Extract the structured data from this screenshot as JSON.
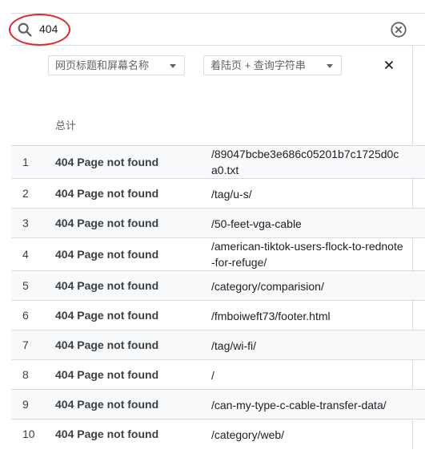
{
  "search": {
    "value": "404"
  },
  "filters": {
    "dimension1": "网页标题和屏幕名称",
    "dimension2_left": "着陆页",
    "dimension2_plus": "+",
    "dimension2_right": "查询字符串"
  },
  "table": {
    "total_label": "总计",
    "rows": [
      {
        "index": "1",
        "title": "404 Page not found",
        "path": "/89047bcbe3e686c05201b7c1725d0ca0.txt"
      },
      {
        "index": "2",
        "title": "404 Page not found",
        "path": "/tag/u-s/"
      },
      {
        "index": "3",
        "title": "404 Page not found",
        "path": "/50-feet-vga-cable"
      },
      {
        "index": "4",
        "title": "404 Page not found",
        "path": "/american-tiktok-users-flock-to-rednote-for-refuge/"
      },
      {
        "index": "5",
        "title": "404 Page not found",
        "path": "/category/comparision/"
      },
      {
        "index": "6",
        "title": "404 Page not found",
        "path": "/fmboiweft73/footer.html"
      },
      {
        "index": "7",
        "title": "404 Page not found",
        "path": "/tag/wi-fi/"
      },
      {
        "index": "8",
        "title": "404 Page not found",
        "path": "/"
      },
      {
        "index": "9",
        "title": "404 Page not found",
        "path": "/can-my-type-c-cable-transfer-data/"
      },
      {
        "index": "10",
        "title": "404 Page not found",
        "path": "/category/web/"
      }
    ]
  },
  "icons": {
    "search": "search-icon",
    "clear": "clear-circle-icon",
    "close": "close-icon",
    "caret": "chevron-down-icon"
  },
  "colors": {
    "highlight": "#e3262b",
    "border": "#dadce0",
    "shaded_row": "#f8f9fa"
  }
}
